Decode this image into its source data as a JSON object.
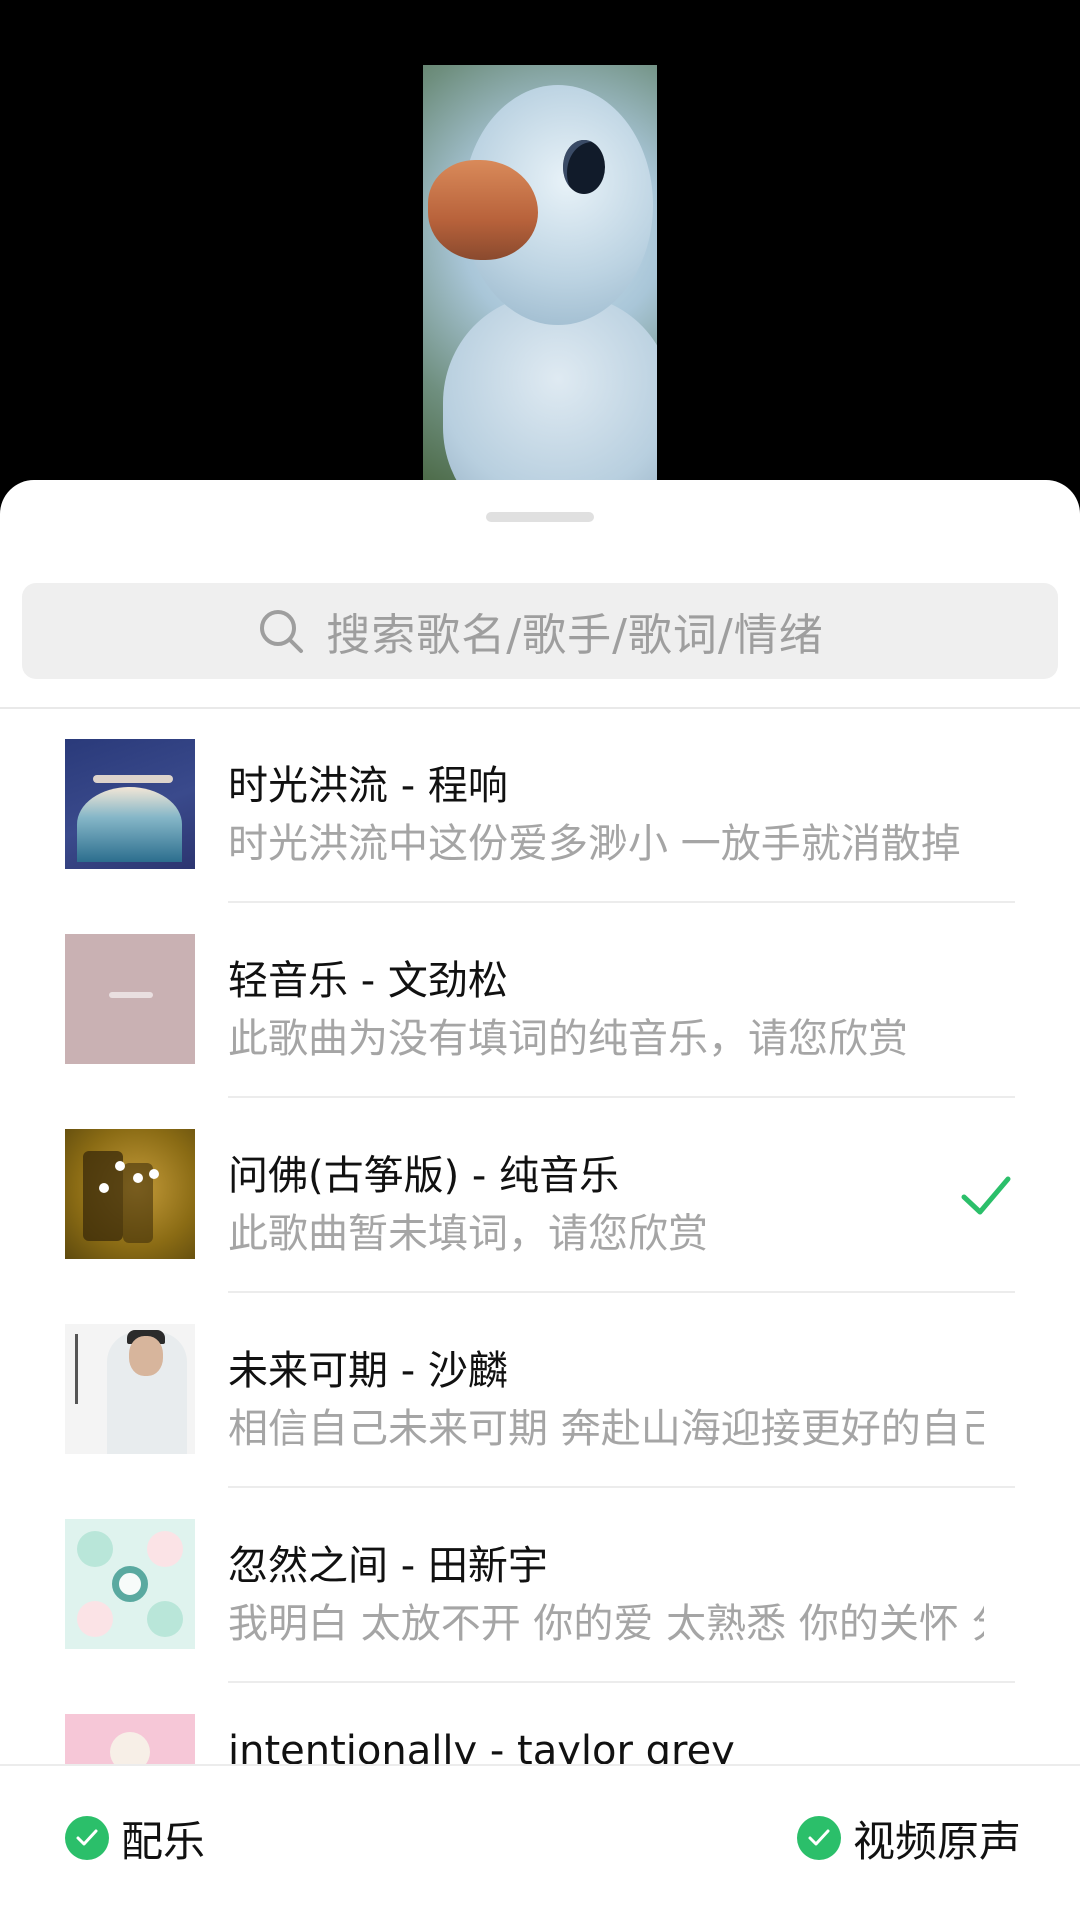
{
  "search": {
    "placeholder": "搜索歌名/歌手/歌词/情绪"
  },
  "songs": [
    {
      "title": "时光洪流 - 程响",
      "lyric": "时光洪流中这份爱多渺小  一放手就消散掉",
      "selected": false
    },
    {
      "title": "轻音乐 - 文劲松",
      "lyric": "此歌曲为没有填词的纯音乐，请您欣赏",
      "selected": false
    },
    {
      "title": "问佛(古筝版) - 纯音乐",
      "lyric": "此歌曲暂未填词，请您欣赏",
      "selected": true
    },
    {
      "title": "未来可期 - 沙麟",
      "lyric": "相信自己未来可期  奔赴山海迎接更好的自己",
      "selected": false
    },
    {
      "title": "忽然之间 - 田新宇",
      "lyric": "我明白 太放不开 你的爱  太熟悉 你的关怀 分",
      "selected": false
    },
    {
      "title": "intentionally - taylor grey",
      "lyric": "",
      "selected": false
    }
  ],
  "footer": {
    "music_label": "配乐",
    "original_audio_label": "视频原声",
    "accent_color": "#2bbf6a"
  },
  "icons": [
    "search-icon",
    "check-icon",
    "check-circle-icon"
  ]
}
